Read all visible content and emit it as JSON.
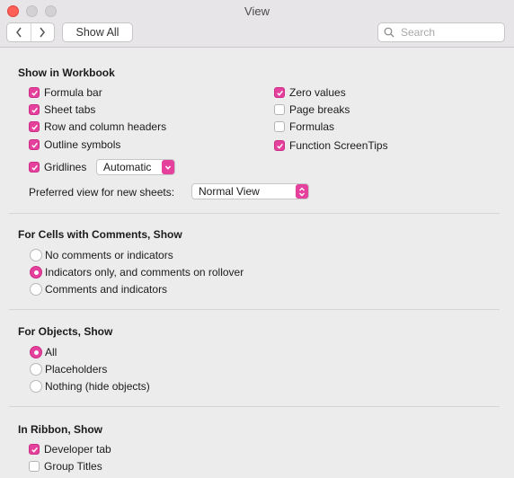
{
  "window": {
    "title": "View"
  },
  "toolbar": {
    "show_all": "Show All",
    "search_placeholder": "Search"
  },
  "accent_color": "#e5409b",
  "workbook": {
    "title": "Show in Workbook",
    "formula_bar": {
      "label": "Formula bar",
      "checked": true
    },
    "sheet_tabs": {
      "label": "Sheet tabs",
      "checked": true
    },
    "row_col_headers": {
      "label": "Row and column headers",
      "checked": true
    },
    "outline_symbols": {
      "label": "Outline symbols",
      "checked": true
    },
    "gridlines": {
      "label": "Gridlines",
      "checked": true
    },
    "gridlines_color": "Automatic",
    "zero_values": {
      "label": "Zero values",
      "checked": true
    },
    "page_breaks": {
      "label": "Page breaks",
      "checked": false
    },
    "formulas": {
      "label": "Formulas",
      "checked": false
    },
    "function_tips": {
      "label": "Function ScreenTips",
      "checked": true
    },
    "preferred_view_label": "Preferred view for new sheets:",
    "preferred_view_value": "Normal View"
  },
  "comments": {
    "title": "For Cells with Comments, Show",
    "options": [
      "No comments or indicators",
      "Indicators only, and comments on rollover",
      "Comments and indicators"
    ],
    "selected": 1
  },
  "objects": {
    "title": "For Objects, Show",
    "options": [
      "All",
      "Placeholders",
      "Nothing (hide objects)"
    ],
    "selected": 0
  },
  "ribbon": {
    "title": "In Ribbon, Show",
    "developer_tab": {
      "label": "Developer tab",
      "checked": true
    },
    "group_titles": {
      "label": "Group Titles",
      "checked": false
    }
  }
}
